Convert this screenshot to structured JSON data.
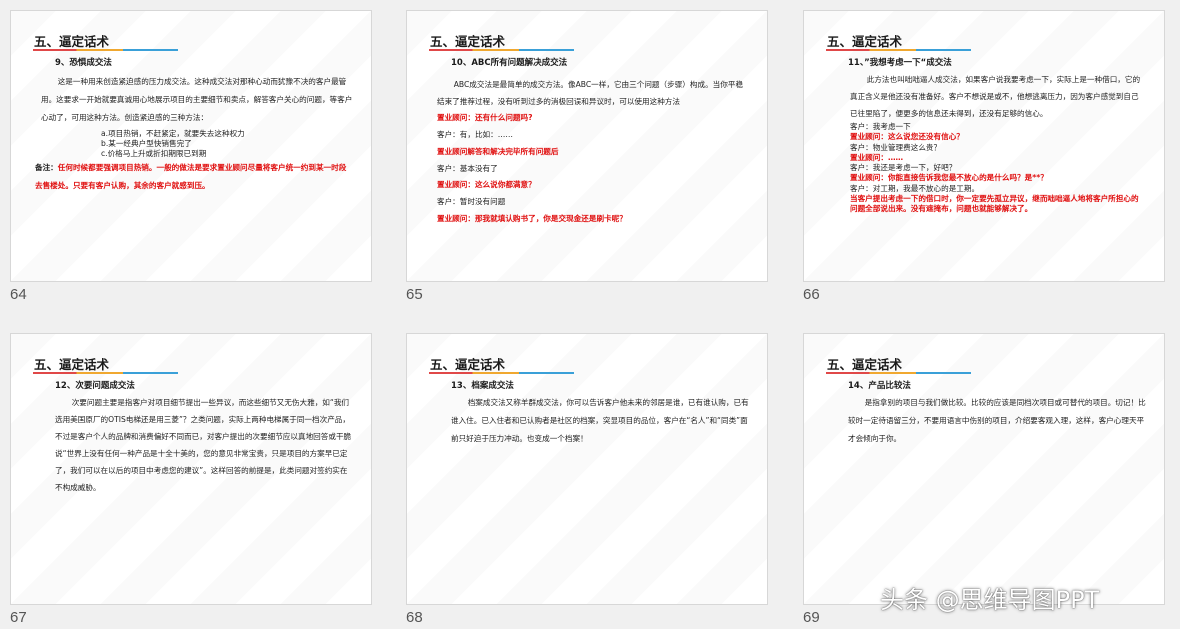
{
  "slides": [
    {
      "num": "64",
      "title": "五、逼定话术",
      "subtitle": "9、恐惧成交法",
      "para1": "这是一种用来创造紧迫感的压力成交法。这种成交法对那种心动而犹豫不决的客户最管用。这要求一开始就要真诚用心地展示项目的主要细节和卖点，解答客户关心的问题，等客户心动了，可用这种方法。创造紧迫感的三种方法：",
      "opt_a": "a.项目热销，不赶紧定，就要失去这种权力",
      "opt_b": "b.某一经典户型快销售完了",
      "opt_c": "c.价格马上升或折扣期限已到期",
      "note_label": "备注：",
      "note_text": "任何时候都要强调项目热销。一般的做法是要求置业顾问尽量将客户统一约到某一时段去售楼处。只要有客户认购，其余的客户就感到压。"
    },
    {
      "num": "65",
      "title": "五、逼定话术",
      "subtitle": "10、ABC所有问题解决成交法",
      "para1": "ABC成交法是最简单的成交方法。像ABC一样，它由三个问题（步骤）构成。当你平稳结束了推荐过程，没有听到过多的消极回误和异议时，可以使用这种方法",
      "l1": "置业顾问：还有什么问题吗?",
      "l2": "客户：有，比如：……",
      "l3": "置业顾问解答和解决完毕所有问题后",
      "l4": "客户：基本没有了",
      "l5": "置业顾问：这么说你都满意？",
      "l6": "客户：暂时没有问题",
      "l7": "置业顾问：那我就填认购书了，你是交现金还是刷卡呢？"
    },
    {
      "num": "66",
      "title": "五、逼定话术",
      "subtitle": "11、”我想考虑一下“成交法",
      "para1": "此方法也叫咄咄逼人成交法，如果客户说我要考虑一下，实际上是一种借口，它的真正含义是他还没有准备好。客户不想说是或不，他想逃离压力，因为客户感觉到自己已往里陷了，便更多的信息还未得到，还没有足够的信心。",
      "l1": "客户：我考虑一下",
      "l2": "置业顾问：这么说您还没有信心？",
      "l3": "客户：物业管理费这么贵？",
      "l4": "置业顾问：……",
      "l5": "客户：我还是考虑一下，好吧？",
      "l6": "置业顾问：你能直接告诉我您最不放心的是什么吗？是**？",
      "l7": "客户：对工期，我最不放心的是工期。",
      "l8": "当客户提出考虑一下的借口时，你一定要先孤立异议，继而咄咄逼人地将客户所担心的问题全部说出来。没有遮掩布，问题也就能够解决了。"
    },
    {
      "num": "67",
      "title": "五、逼定话术",
      "subtitle": "12、次要问题成交法",
      "para1": "次要问题主要是指客户对项目细节提出一些异议，而这些细节又无伤大雅，如“我们选用美国原厂的OTIS电梯还是用三菱”？之类问题，实际上两种电梯属于同一档次产品，不过是客户个人的品牌和消费偏好不同而已，对客户提出的次要细节应以真地回答或干脆说“世界上没有任何一种产品是十全十美的，您的意见非常宝贵，只是项目的方案早已定了，我们可以在以后的项目中考虑您的建议”。这样回答的前提是，此类问题对签约实在不构成威胁。"
    },
    {
      "num": "68",
      "title": "五、逼定话术",
      "subtitle": "13、档案成交法",
      "para1": "档案成交法又称羊群成交法，你可以告诉客户他未来的邻居是谁，已有谁认购，已有谁入住。已入住者和已认购者是社区的档案，突显项目的品位，客户在“名人”和“同类”面前只好迫于压力冲动。也变成一个档案！"
    },
    {
      "num": "69",
      "title": "五、逼定话术",
      "subtitle": "14、产品比较法",
      "para1": "是指拿别的项目与我们做比较。比较的应该是同档次项目或可替代的项目。切记！比较时一定待语留三分，不要用语言中伤别的项目，介绍要客观入理，这样，客户心理天平才会倾向于你。"
    }
  ],
  "watermark": "头条 @思维导图PPT"
}
